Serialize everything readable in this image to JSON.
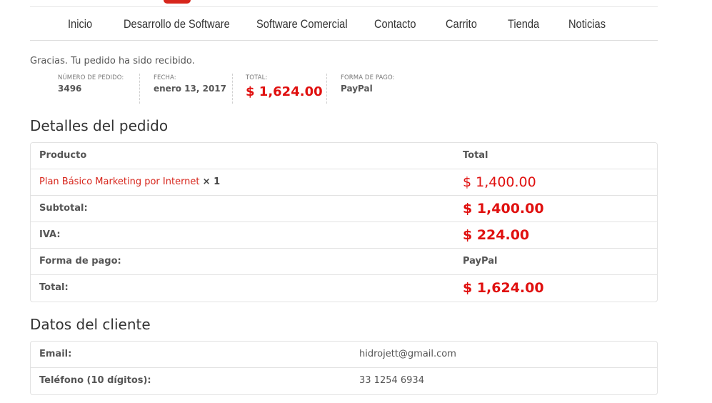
{
  "nav": {
    "items": [
      {
        "label": "Inicio"
      },
      {
        "label": "Desarrollo de Software"
      },
      {
        "label": "Software Comercial"
      },
      {
        "label": "Contacto"
      },
      {
        "label": "Carrito"
      },
      {
        "label": "Tienda"
      },
      {
        "label": "Noticias"
      }
    ]
  },
  "thanks": "Gracias. Tu pedido ha sido recibido.",
  "overview": {
    "order_number": {
      "label": "NÚMERO DE PEDIDO:",
      "value": "3496"
    },
    "date": {
      "label": "FECHA:",
      "value": "enero 13, 2017"
    },
    "total": {
      "label": "TOTAL:",
      "value": "$ 1,624.00"
    },
    "payment": {
      "label": "FORMA DE PAGO:",
      "value": "PayPal"
    }
  },
  "order_details": {
    "title": "Detalles del pedido",
    "header": {
      "product": "Producto",
      "total": "Total"
    },
    "item": {
      "name": "Plan Básico Marketing por Internet",
      "qty": "× 1",
      "total": "$ 1,400.00"
    },
    "subtotal": {
      "label": "Subtotal:",
      "value": "$ 1,400.00"
    },
    "tax": {
      "label": "IVA:",
      "value": "$ 224.00"
    },
    "payment": {
      "label": "Forma de pago:",
      "value": "PayPal"
    },
    "total": {
      "label": "Total:",
      "value": "$ 1,624.00"
    }
  },
  "customer": {
    "title": "Datos del cliente",
    "email": {
      "label": "Email:",
      "value": "hidrojett@gmail.com"
    },
    "phone": {
      "label": "Teléfono (10 dígitos):",
      "value": "33 1254 6934"
    }
  },
  "colors": {
    "accent": "#d7261c",
    "price": "#e0100f"
  }
}
